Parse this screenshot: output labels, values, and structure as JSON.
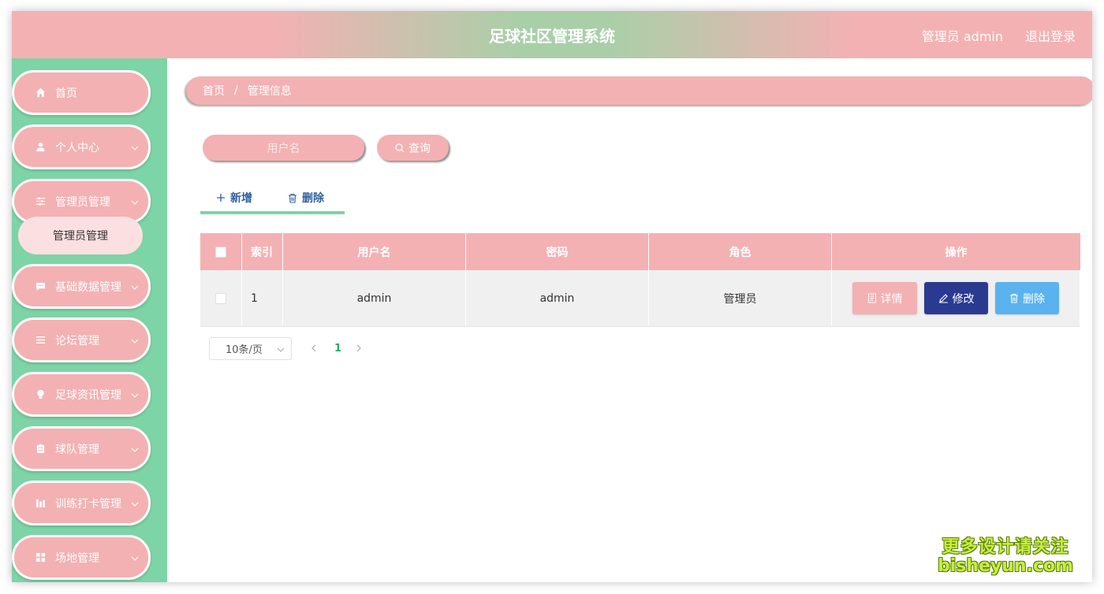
{
  "header": {
    "title": "足球社区管理系统",
    "user": "管理员 admin",
    "logout": "退出登录"
  },
  "sidebar": {
    "items": [
      {
        "label": "首页",
        "icon": "home-icon"
      },
      {
        "label": "个人中心",
        "icon": "user-icon"
      },
      {
        "label": "管理员管理",
        "icon": "sliders-icon"
      },
      {
        "label": "基础数据管理",
        "icon": "message-icon"
      },
      {
        "label": "论坛管理",
        "icon": "list-icon"
      },
      {
        "label": "足球资讯管理",
        "icon": "bulb-icon"
      },
      {
        "label": "球队管理",
        "icon": "clipboard-icon"
      },
      {
        "label": "训练打卡管理",
        "icon": "chart-icon"
      },
      {
        "label": "场地管理",
        "icon": "grid-icon"
      }
    ],
    "submenu": "管理员管理"
  },
  "breadcrumb": {
    "home": "首页",
    "separator": "/",
    "current": "管理信息"
  },
  "search": {
    "placeholder": "用户名",
    "button": "查询"
  },
  "actions": {
    "add": "新增",
    "delete": "删除"
  },
  "table": {
    "headers": {
      "index": "索引",
      "username": "用户名",
      "password": "密码",
      "role": "角色",
      "operation": "操作"
    },
    "rows": [
      {
        "index": "1",
        "username": "admin",
        "password": "admin",
        "role": "管理员"
      }
    ],
    "buttons": {
      "detail": "详情",
      "edit": "修改",
      "delete": "删除"
    }
  },
  "pagination": {
    "page_size": "10条/页",
    "current_page": "1"
  },
  "watermark": {
    "line1": "更多设计请关注",
    "line2": "bisheyun.com"
  },
  "colors": {
    "pink": "#f3b1b3",
    "green": "#7dd4a6",
    "edit_blue": "#2b3a91",
    "delete_blue": "#5ab3ee"
  }
}
